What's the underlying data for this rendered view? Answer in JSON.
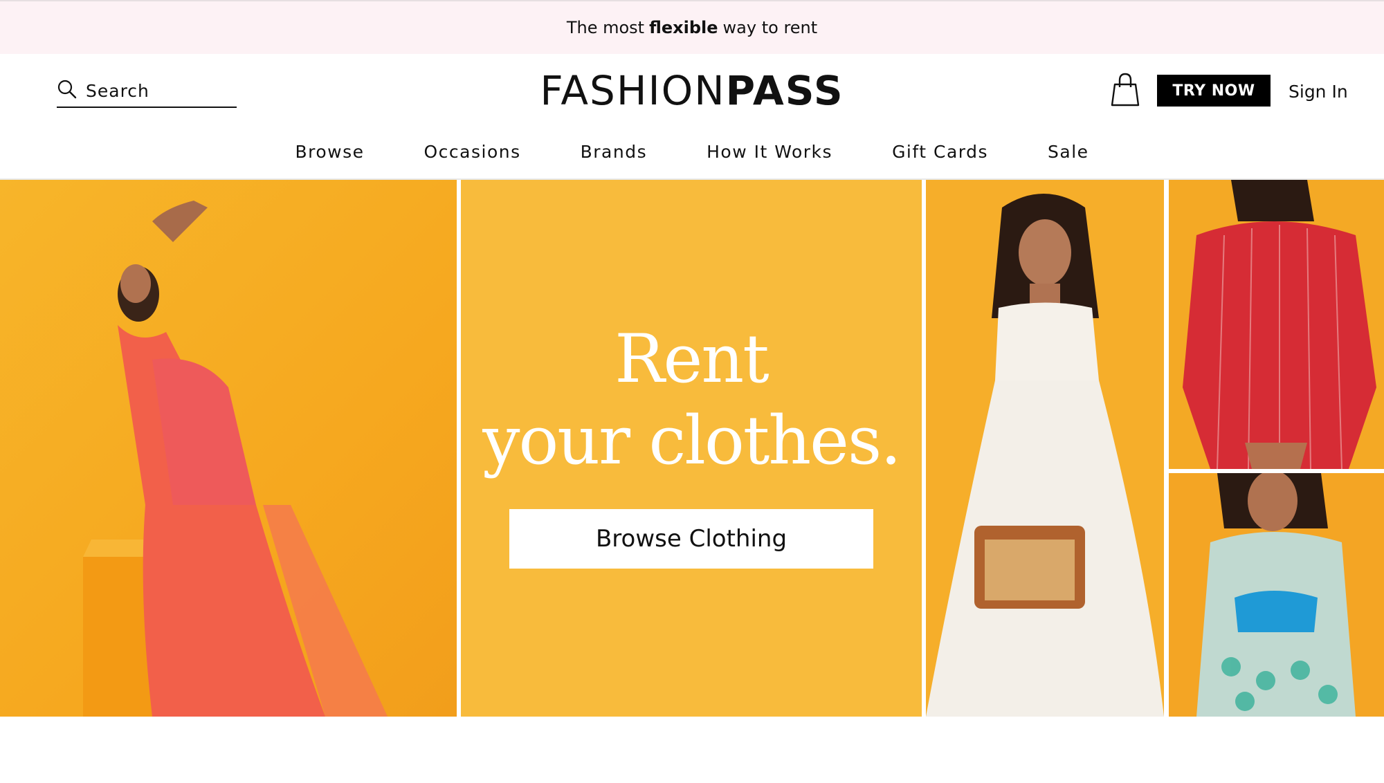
{
  "banner": {
    "prefix": "The most",
    "emphasis": "flexible",
    "suffix": "way to rent"
  },
  "header": {
    "search_label": "Search",
    "logo_light": "FASHION",
    "logo_bold": "PASS",
    "try_now": "TRY NOW",
    "sign_in": "Sign In"
  },
  "nav": {
    "items": [
      "Browse",
      "Occasions",
      "Brands",
      "How It Works",
      "Gift Cards",
      "Sale"
    ]
  },
  "hero": {
    "headline_line1": "Rent",
    "headline_line2": "your clothes.",
    "cta": "Browse Clothing"
  },
  "colors": {
    "banner_bg": "#fdf2f5",
    "hero_yellow": "#f8bb3c",
    "button_black": "#000000"
  },
  "icons": {
    "search": "search-icon",
    "bag": "shopping-bag-icon"
  }
}
